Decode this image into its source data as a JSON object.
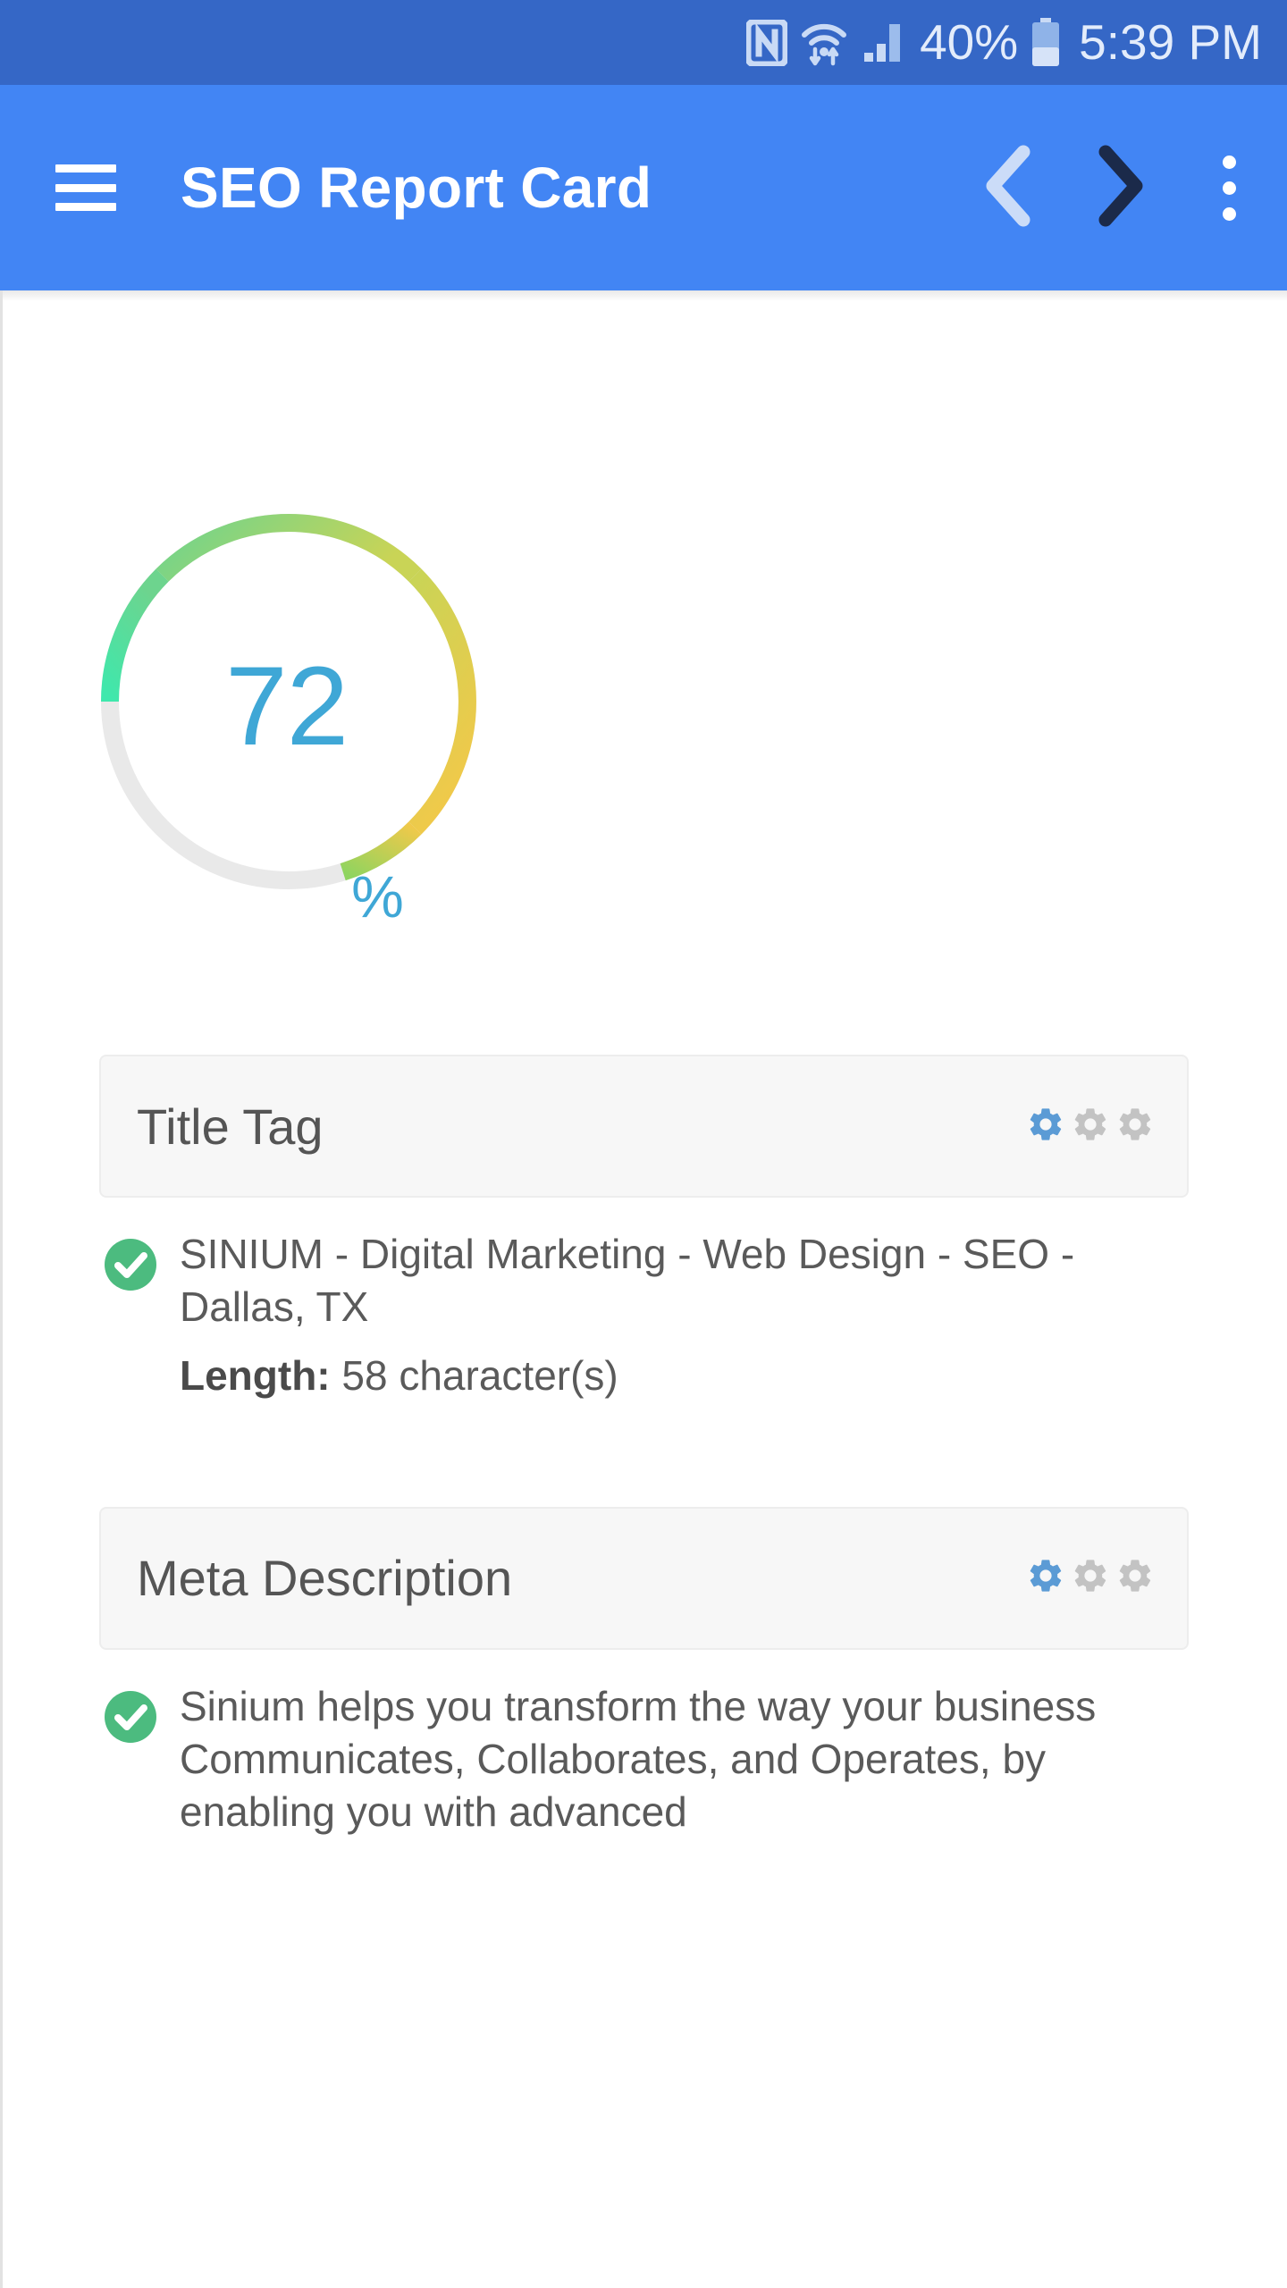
{
  "status_bar": {
    "icons": [
      "nfc-icon",
      "wifi-icon",
      "cellular-signal-icon",
      "battery-icon"
    ],
    "battery_percent": "40%",
    "time": "5:39 PM",
    "background_color": "#3567C6",
    "foreground_color": "#E3ECFB"
  },
  "app_bar": {
    "menu_icon": "hamburger-menu-icon",
    "title": "SEO Report Card",
    "prev_icon": "chevron-left-icon",
    "next_icon": "chevron-right-icon",
    "overflow_icon": "more-vertical-icon",
    "prev_enabled": false,
    "next_enabled": true,
    "background_color": "#4285F4",
    "title_color": "#FFFFFF"
  },
  "score_gauge": {
    "value": "72",
    "unit": "%",
    "value_color": "#3FA7D6",
    "track_color": "#E8E8E8",
    "arc_colors": [
      "#3EE8AD",
      "#5FD998",
      "#7DCC85",
      "#A9D468",
      "#C9D456",
      "#EFCB45",
      "#F0C94A",
      "#8FD45F"
    ],
    "percent": 72
  },
  "sections": [
    {
      "title": "Title Tag",
      "rating_icon": "gear-icon",
      "rating_filled": 1,
      "rating_total": 3,
      "rating_filled_color": "#5B9BD5",
      "rating_empty_color": "#C3C3C3",
      "status_icon": "check-circle-icon",
      "status_color": "#4CBB7F",
      "content": "SINIUM - Digital Marketing - Web Design - SEO - Dallas, TX",
      "length_label": "Length:",
      "length_value": "58 character(s)"
    },
    {
      "title": "Meta Description",
      "rating_icon": "gear-icon",
      "rating_filled": 1,
      "rating_total": 3,
      "rating_filled_color": "#5B9BD5",
      "rating_empty_color": "#C3C3C3",
      "status_icon": "check-circle-icon",
      "status_color": "#4CBB7F",
      "content": "Sinium helps you transform the way your business Communicates, Collaborates, and Operates, by enabling you with advanced"
    }
  ]
}
